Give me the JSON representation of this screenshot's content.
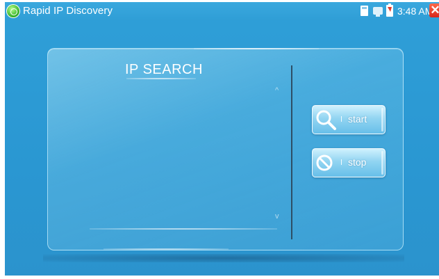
{
  "app": {
    "title": "Rapid IP Discovery",
    "icon": "app-logo-icon"
  },
  "status": {
    "time": "3:48 AM",
    "icons": [
      "sd-card-icon",
      "network-icon",
      "battery-charging-icon",
      "close-icon"
    ],
    "close_glyph": "✕"
  },
  "panel": {
    "title": "IP SEARCH",
    "results": [],
    "scroll_up": "^",
    "scroll_down": "v"
  },
  "buttons": {
    "start_label": "start",
    "stop_label": "stop"
  },
  "colors": {
    "background": "#2f9fd8",
    "accent": "#ffffff",
    "close": "#e0301f"
  }
}
